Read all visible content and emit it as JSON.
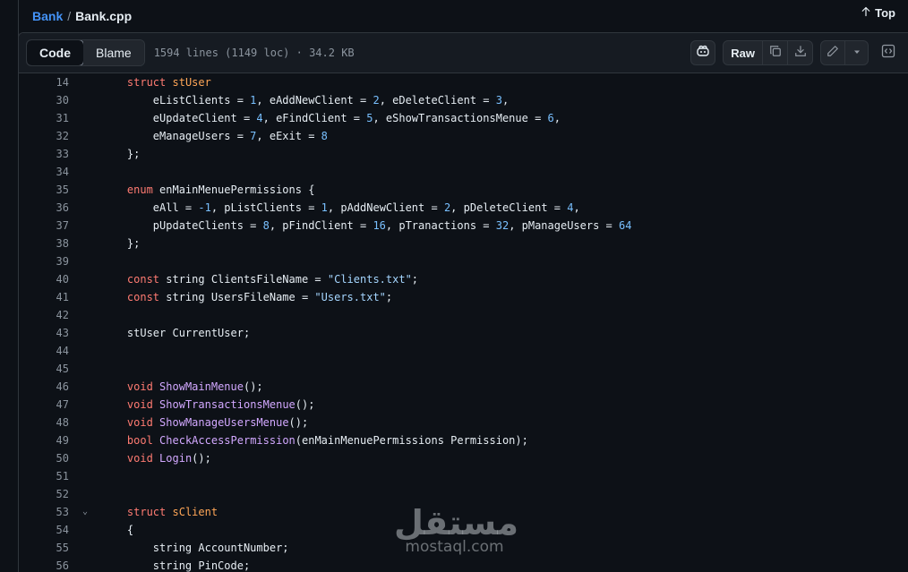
{
  "breadcrumb": {
    "repo": "Bank",
    "separator": "/",
    "file": "Bank.cpp"
  },
  "top_link": {
    "label": "Top",
    "icon": "arrow-up-icon"
  },
  "tabs": {
    "code": "Code",
    "blame": "Blame",
    "active": "Code"
  },
  "file_meta": "1594 lines (1149 loc) · 34.2 KB",
  "toolbar": {
    "copilot_icon": "copilot-icon",
    "raw_label": "Raw",
    "copy_icon": "copy-icon",
    "download_icon": "download-icon",
    "edit_icon": "pencil-icon",
    "more_icon": "triangle-down-icon",
    "symbols_icon": "code-square-icon"
  },
  "colors": {
    "background": "#0d1117",
    "keyword": "#ff7b72",
    "type": "#ffa657",
    "function": "#d2a8ff",
    "number": "#79c0ff",
    "string": "#a5d6ff",
    "link": "#4493f8"
  },
  "code_lines": [
    {
      "n": "14",
      "fold": "",
      "tokens": [
        [
          "    ",
          ""
        ],
        [
          "struct",
          "k"
        ],
        [
          " ",
          ""
        ],
        [
          "stUser",
          "t"
        ]
      ]
    },
    {
      "n": "30",
      "fold": "",
      "tokens": [
        [
          "        eListClients = ",
          ""
        ],
        [
          "1",
          "n"
        ],
        [
          ", eAddNewClient = ",
          ""
        ],
        [
          "2",
          "n"
        ],
        [
          ", eDeleteClient = ",
          ""
        ],
        [
          "3",
          "n"
        ],
        [
          ",",
          ""
        ]
      ]
    },
    {
      "n": "31",
      "fold": "",
      "tokens": [
        [
          "        eUpdateClient = ",
          ""
        ],
        [
          "4",
          "n"
        ],
        [
          ", eFindClient = ",
          ""
        ],
        [
          "5",
          "n"
        ],
        [
          ", eShowTransactionsMenue = ",
          ""
        ],
        [
          "6",
          "n"
        ],
        [
          ",",
          ""
        ]
      ]
    },
    {
      "n": "32",
      "fold": "",
      "tokens": [
        [
          "        eManageUsers = ",
          ""
        ],
        [
          "7",
          "n"
        ],
        [
          ", eExit = ",
          ""
        ],
        [
          "8",
          "n"
        ]
      ]
    },
    {
      "n": "33",
      "fold": "",
      "tokens": [
        [
          "    };",
          ""
        ]
      ]
    },
    {
      "n": "34",
      "fold": "",
      "tokens": []
    },
    {
      "n": "35",
      "fold": "",
      "tokens": [
        [
          "    ",
          ""
        ],
        [
          "enum",
          "k"
        ],
        [
          " enMainMenuePermissions {",
          ""
        ]
      ]
    },
    {
      "n": "36",
      "fold": "",
      "tokens": [
        [
          "        eAll = ",
          ""
        ],
        [
          "-1",
          "n"
        ],
        [
          ", pListClients = ",
          ""
        ],
        [
          "1",
          "n"
        ],
        [
          ", pAddNewClient = ",
          ""
        ],
        [
          "2",
          "n"
        ],
        [
          ", pDeleteClient = ",
          ""
        ],
        [
          "4",
          "n"
        ],
        [
          ",",
          ""
        ]
      ]
    },
    {
      "n": "37",
      "fold": "",
      "tokens": [
        [
          "        pUpdateClients = ",
          ""
        ],
        [
          "8",
          "n"
        ],
        [
          ", pFindClient = ",
          ""
        ],
        [
          "16",
          "n"
        ],
        [
          ", pTranactions = ",
          ""
        ],
        [
          "32",
          "n"
        ],
        [
          ", pManageUsers = ",
          ""
        ],
        [
          "64",
          "n"
        ]
      ]
    },
    {
      "n": "38",
      "fold": "",
      "tokens": [
        [
          "    };",
          ""
        ]
      ]
    },
    {
      "n": "39",
      "fold": "",
      "tokens": []
    },
    {
      "n": "40",
      "fold": "",
      "tokens": [
        [
          "    ",
          ""
        ],
        [
          "const",
          "k"
        ],
        [
          " string ClientsFileName = ",
          ""
        ],
        [
          "\"Clients.txt\"",
          "s"
        ],
        [
          ";",
          ""
        ]
      ]
    },
    {
      "n": "41",
      "fold": "",
      "tokens": [
        [
          "    ",
          ""
        ],
        [
          "const",
          "k"
        ],
        [
          " string UsersFileName = ",
          ""
        ],
        [
          "\"Users.txt\"",
          "s"
        ],
        [
          ";",
          ""
        ]
      ]
    },
    {
      "n": "42",
      "fold": "",
      "tokens": []
    },
    {
      "n": "43",
      "fold": "",
      "tokens": [
        [
          "    stUser CurrentUser;",
          ""
        ]
      ]
    },
    {
      "n": "44",
      "fold": "",
      "tokens": []
    },
    {
      "n": "45",
      "fold": "",
      "tokens": []
    },
    {
      "n": "46",
      "fold": "",
      "tokens": [
        [
          "    ",
          ""
        ],
        [
          "void",
          "k"
        ],
        [
          " ",
          ""
        ],
        [
          "ShowMainMenue",
          "f"
        ],
        [
          "();",
          ""
        ]
      ]
    },
    {
      "n": "47",
      "fold": "",
      "tokens": [
        [
          "    ",
          ""
        ],
        [
          "void",
          "k"
        ],
        [
          " ",
          ""
        ],
        [
          "ShowTransactionsMenue",
          "f"
        ],
        [
          "();",
          ""
        ]
      ]
    },
    {
      "n": "48",
      "fold": "",
      "tokens": [
        [
          "    ",
          ""
        ],
        [
          "void",
          "k"
        ],
        [
          " ",
          ""
        ],
        [
          "ShowManageUsersMenue",
          "f"
        ],
        [
          "();",
          ""
        ]
      ]
    },
    {
      "n": "49",
      "fold": "",
      "tokens": [
        [
          "    ",
          ""
        ],
        [
          "bool",
          "k"
        ],
        [
          " ",
          ""
        ],
        [
          "CheckAccessPermission",
          "f"
        ],
        [
          "(enMainMenuePermissions Permission);",
          ""
        ]
      ]
    },
    {
      "n": "50",
      "fold": "",
      "tokens": [
        [
          "    ",
          ""
        ],
        [
          "void",
          "k"
        ],
        [
          " ",
          ""
        ],
        [
          "Login",
          "f"
        ],
        [
          "();",
          ""
        ]
      ]
    },
    {
      "n": "51",
      "fold": "",
      "tokens": []
    },
    {
      "n": "52",
      "fold": "",
      "tokens": []
    },
    {
      "n": "53",
      "fold": "⌄",
      "tokens": [
        [
          "    ",
          ""
        ],
        [
          "struct",
          "k"
        ],
        [
          " ",
          ""
        ],
        [
          "sClient",
          "t"
        ]
      ]
    },
    {
      "n": "54",
      "fold": "",
      "tokens": [
        [
          "    {",
          ""
        ]
      ]
    },
    {
      "n": "55",
      "fold": "",
      "tokens": [
        [
          "        string AccountNumber;",
          ""
        ]
      ]
    },
    {
      "n": "56",
      "fold": "",
      "tokens": [
        [
          "        string PinCode;",
          ""
        ]
      ]
    }
  ],
  "watermark": {
    "arabic": "مستقل",
    "latin": "mostaql.com"
  }
}
